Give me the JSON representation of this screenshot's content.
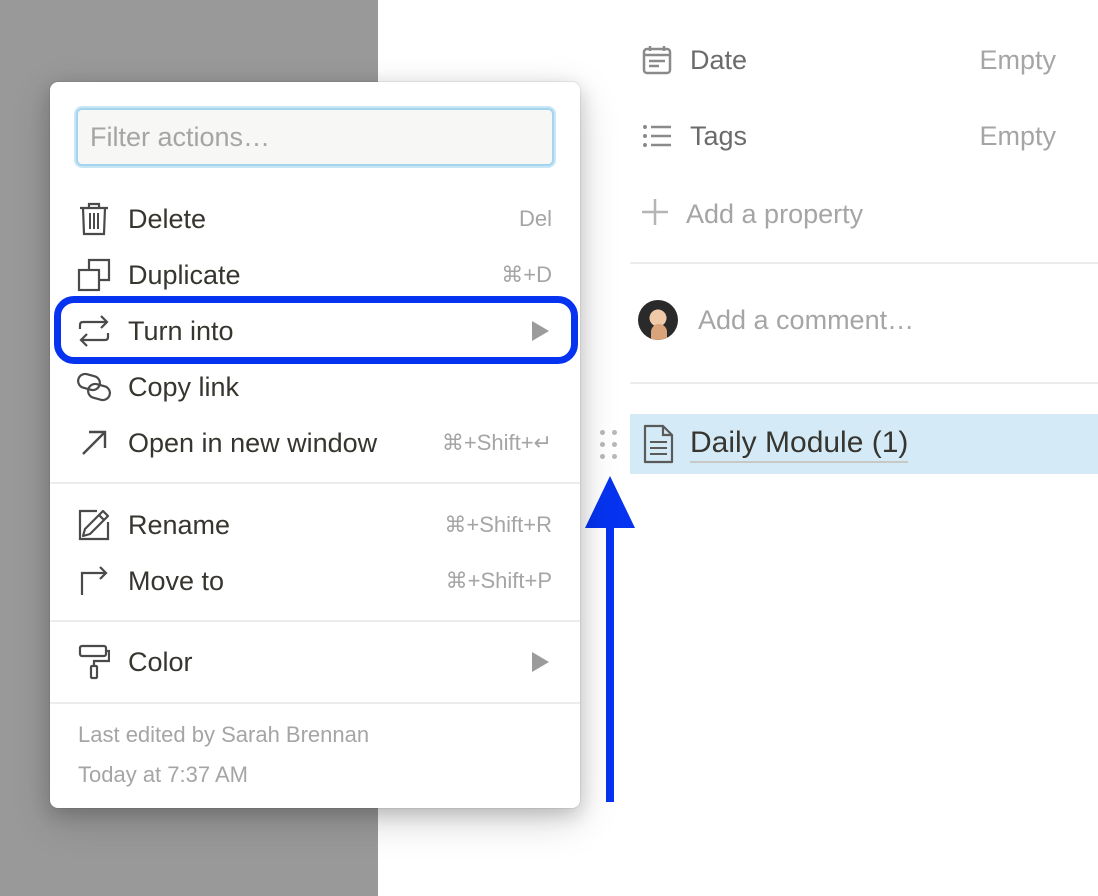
{
  "properties": [
    {
      "name": "Date",
      "value": "Empty",
      "icon": "calendar-icon"
    },
    {
      "name": "Tags",
      "value": "Empty",
      "icon": "list-icon"
    }
  ],
  "add_property": {
    "label": "Add a property",
    "icon": "plus-icon"
  },
  "comment": {
    "placeholder": "Add a comment…",
    "icon": "avatar"
  },
  "block": {
    "title": "Daily Module (1)",
    "icon": "page-icon"
  },
  "menu": {
    "filter_placeholder": "Filter actions…",
    "items": [
      {
        "label": "Delete",
        "shortcut": "Del",
        "icon": "trash-icon"
      },
      {
        "label": "Duplicate",
        "shortcut": "⌘+D",
        "icon": "duplicate-icon"
      },
      {
        "label": "Turn into",
        "shortcut": "",
        "icon": "turn-into-icon",
        "submenu": true
      },
      {
        "label": "Copy link",
        "shortcut": "",
        "icon": "link-icon"
      },
      {
        "label": "Open in new window",
        "shortcut": "⌘+Shift+↵",
        "icon": "arrow-up-right-icon"
      },
      {
        "label": "Rename",
        "shortcut": "⌘+Shift+R",
        "icon": "pencil-icon"
      },
      {
        "label": "Move to",
        "shortcut": "⌘+Shift+P",
        "icon": "move-to-icon"
      },
      {
        "label": "Color",
        "shortcut": "",
        "icon": "paint-roller-icon",
        "submenu": true
      }
    ],
    "footer": {
      "edited_by": "Last edited by Sarah Brennan",
      "edited_at": "Today at 7:37 AM"
    }
  },
  "colors": {
    "highlight_outline": "#0633f0",
    "arrow": "#0633f0",
    "block_selected_bg": "#d4ebf7",
    "overlay_gray": "#999999"
  }
}
